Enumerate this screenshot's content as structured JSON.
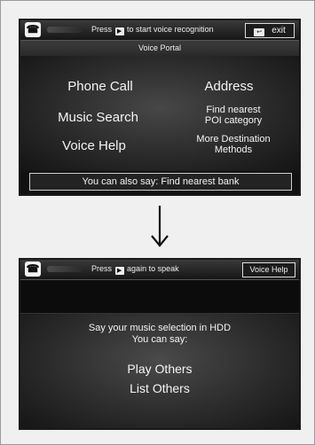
{
  "screen1": {
    "phone_icon_glyph": "☎",
    "hint_prefix": "Press",
    "hint_suffix": "to start voice recognition",
    "exit_label": "exit",
    "portal_title": "Voice Portal",
    "menu": {
      "phone_call": "Phone Call",
      "address": "Address",
      "music_search": "Music Search",
      "find_nearest_poi_line1": "Find nearest",
      "find_nearest_poi_line2": "POI category",
      "voice_help": "Voice Help",
      "more_destination_line1": "More Destination",
      "more_destination_line2": "Methods"
    },
    "also_say": "You can also say: Find nearest bank"
  },
  "arrow_glyph": "down-arrow-icon",
  "screen2": {
    "phone_icon_glyph": "☎",
    "hint_prefix": "Press",
    "hint_suffix": "again to speak",
    "voice_help_button": "Voice Help",
    "say_title": "Say your music selection in HDD",
    "say_sub": "You can say:",
    "options": [
      "Play Others",
      "List Others"
    ]
  },
  "colors": {
    "screen_bg": "#111111",
    "text": "#f2f2f2",
    "frame_bg": "#f0f0f0"
  }
}
